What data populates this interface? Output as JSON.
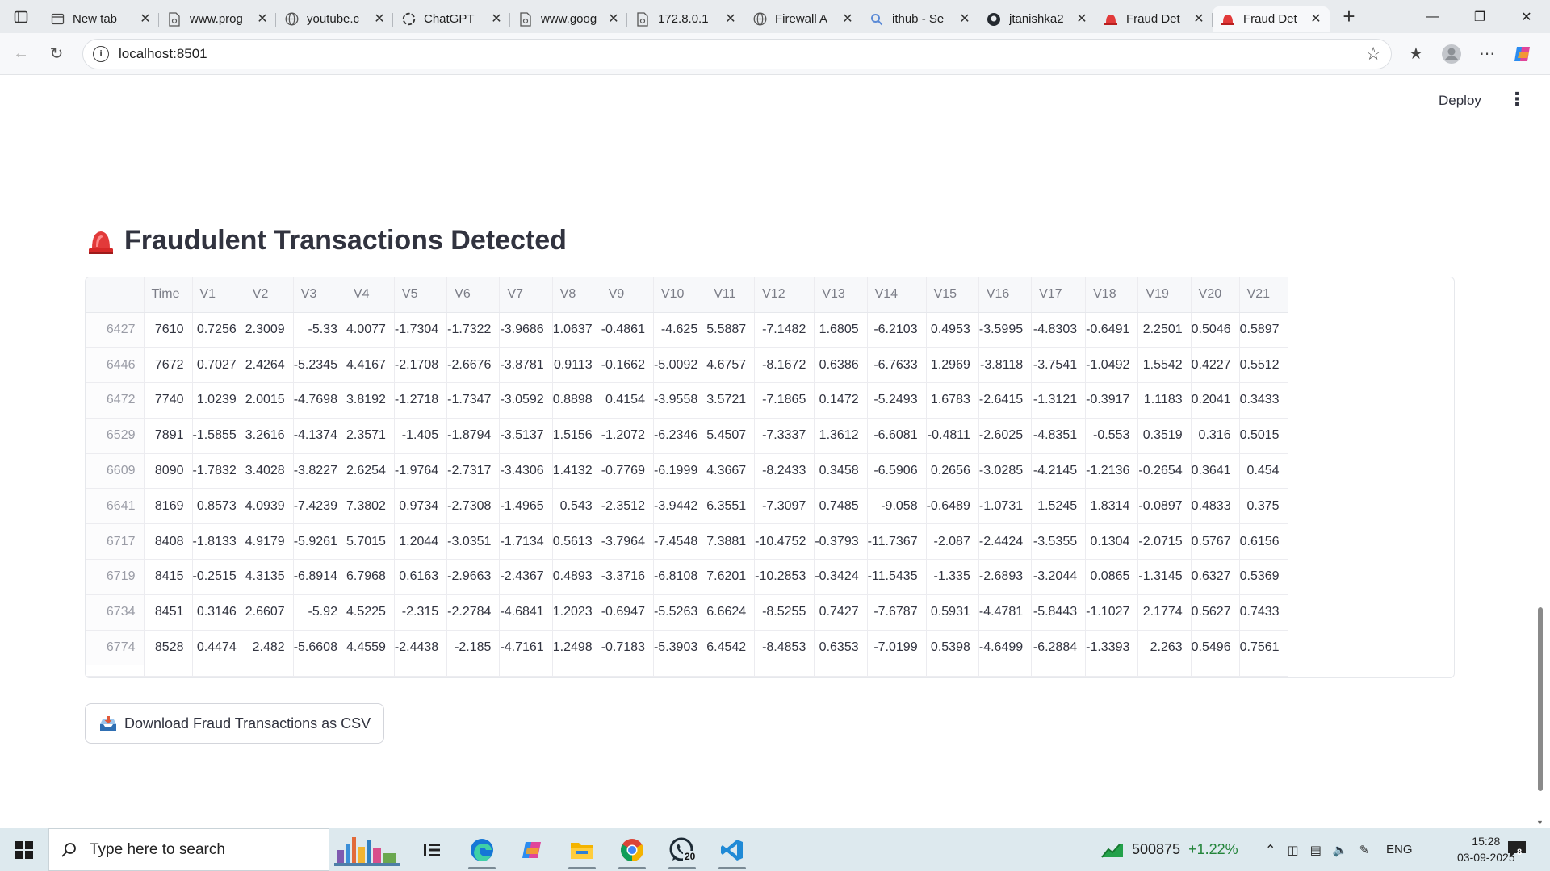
{
  "browser": {
    "tabs": [
      {
        "title": "New tab",
        "icon": "newtab-icon"
      },
      {
        "title": "www.prog",
        "icon": "page-icon"
      },
      {
        "title": "youtube.c",
        "icon": "globe-icon"
      },
      {
        "title": "ChatGPT",
        "icon": "chatgpt-icon"
      },
      {
        "title": "www.goog",
        "icon": "page-icon"
      },
      {
        "title": "172.8.0.1",
        "icon": "page-icon"
      },
      {
        "title": "Firewall A",
        "icon": "globe-icon"
      },
      {
        "title": "ithub - Se",
        "icon": "search-icon"
      },
      {
        "title": "jtanishka2",
        "icon": "github-icon"
      },
      {
        "title": "Fraud Det",
        "icon": "siren-icon"
      },
      {
        "title": "Fraud Det",
        "icon": "siren-icon"
      }
    ],
    "active_tab_index": 10,
    "url": "localhost:8501"
  },
  "app": {
    "deploy_label": "Deploy",
    "heading": "Fraudulent Transactions Detected",
    "download_label": "Download Fraud Transactions as CSV"
  },
  "table": {
    "columns": [
      "",
      "Time",
      "V1",
      "V2",
      "V3",
      "V4",
      "V5",
      "V6",
      "V7",
      "V8",
      "V9",
      "V10",
      "V11",
      "V12",
      "V13",
      "V14",
      "V15",
      "V16",
      "V17",
      "V18",
      "V19",
      "V20",
      "V21"
    ],
    "rows": [
      [
        "6427",
        "7610",
        "0.7256",
        "2.3009",
        "-5.33",
        "4.0077",
        "-1.7304",
        "-1.7322",
        "-3.9686",
        "1.0637",
        "-0.4861",
        "-4.625",
        "5.5887",
        "-7.1482",
        "1.6805",
        "-6.2103",
        "0.4953",
        "-3.5995",
        "-4.8303",
        "-0.6491",
        "2.2501",
        "0.5046",
        "0.5897"
      ],
      [
        "6446",
        "7672",
        "0.7027",
        "2.4264",
        "-5.2345",
        "4.4167",
        "-2.1708",
        "-2.6676",
        "-3.8781",
        "0.9113",
        "-0.1662",
        "-5.0092",
        "4.6757",
        "-8.1672",
        "0.6386",
        "-6.7633",
        "1.2969",
        "-3.8118",
        "-3.7541",
        "-1.0492",
        "1.5542",
        "0.4227",
        "0.5512"
      ],
      [
        "6472",
        "7740",
        "1.0239",
        "2.0015",
        "-4.7698",
        "3.8192",
        "-1.2718",
        "-1.7347",
        "-3.0592",
        "0.8898",
        "0.4154",
        "-3.9558",
        "3.5721",
        "-7.1865",
        "0.1472",
        "-5.2493",
        "1.6783",
        "-2.6415",
        "-1.3121",
        "-0.3917",
        "1.1183",
        "0.2041",
        "0.3433"
      ],
      [
        "6529",
        "7891",
        "-1.5855",
        "3.2616",
        "-4.1374",
        "2.3571",
        "-1.405",
        "-1.8794",
        "-3.5137",
        "1.5156",
        "-1.2072",
        "-6.2346",
        "5.4507",
        "-7.3337",
        "1.3612",
        "-6.6081",
        "-0.4811",
        "-2.6025",
        "-4.8351",
        "-0.553",
        "0.3519",
        "0.316",
        "0.5015"
      ],
      [
        "6609",
        "8090",
        "-1.7832",
        "3.4028",
        "-3.8227",
        "2.6254",
        "-1.9764",
        "-2.7317",
        "-3.4306",
        "1.4132",
        "-0.7769",
        "-6.1999",
        "4.3667",
        "-8.2433",
        "0.3458",
        "-6.5906",
        "0.2656",
        "-3.0285",
        "-4.2145",
        "-1.2136",
        "-0.2654",
        "0.3641",
        "0.454"
      ],
      [
        "6641",
        "8169",
        "0.8573",
        "4.0939",
        "-7.4239",
        "7.3802",
        "0.9734",
        "-2.7308",
        "-1.4965",
        "0.543",
        "-2.3512",
        "-3.9442",
        "6.3551",
        "-7.3097",
        "0.7485",
        "-9.058",
        "-0.6489",
        "-1.0731",
        "1.5245",
        "1.8314",
        "-0.0897",
        "0.4833",
        "0.375"
      ],
      [
        "6717",
        "8408",
        "-1.8133",
        "4.9179",
        "-5.9261",
        "5.7015",
        "1.2044",
        "-3.0351",
        "-1.7134",
        "0.5613",
        "-3.7964",
        "-7.4548",
        "7.3881",
        "-10.4752",
        "-0.3793",
        "-11.7367",
        "-2.087",
        "-2.4424",
        "-3.5355",
        "0.1304",
        "-2.0715",
        "0.5767",
        "0.6156"
      ],
      [
        "6719",
        "8415",
        "-0.2515",
        "4.3135",
        "-6.8914",
        "6.7968",
        "0.6163",
        "-2.9663",
        "-2.4367",
        "0.4893",
        "-3.3716",
        "-6.8108",
        "7.6201",
        "-10.2853",
        "-0.3424",
        "-11.5435",
        "-1.335",
        "-2.6893",
        "-3.2044",
        "0.0865",
        "-1.3145",
        "0.6327",
        "0.5369"
      ],
      [
        "6734",
        "8451",
        "0.3146",
        "2.6607",
        "-5.92",
        "4.5225",
        "-2.315",
        "-2.2784",
        "-4.6841",
        "1.2023",
        "-0.6947",
        "-5.5263",
        "6.6624",
        "-8.5255",
        "0.7427",
        "-7.6787",
        "0.5931",
        "-4.4781",
        "-5.8443",
        "-1.1027",
        "2.1774",
        "0.5627",
        "0.7433"
      ],
      [
        "6774",
        "8528",
        "0.4474",
        "2.482",
        "-5.6608",
        "4.4559",
        "-2.4438",
        "-2.185",
        "-4.7161",
        "1.2498",
        "-0.7183",
        "-5.3903",
        "6.4542",
        "-8.4853",
        "0.6353",
        "-7.0199",
        "0.5398",
        "-4.6499",
        "-6.2884",
        "-1.3393",
        "2.263",
        "0.5496",
        "0.7561"
      ]
    ]
  },
  "taskbar": {
    "search_placeholder": "Type here to search",
    "whatsapp_badge": "20",
    "stock_value": "500875",
    "stock_change": "+1.22%",
    "language": "ENG",
    "time": "15:28",
    "date": "03-09-2025",
    "notification_count": "8"
  }
}
